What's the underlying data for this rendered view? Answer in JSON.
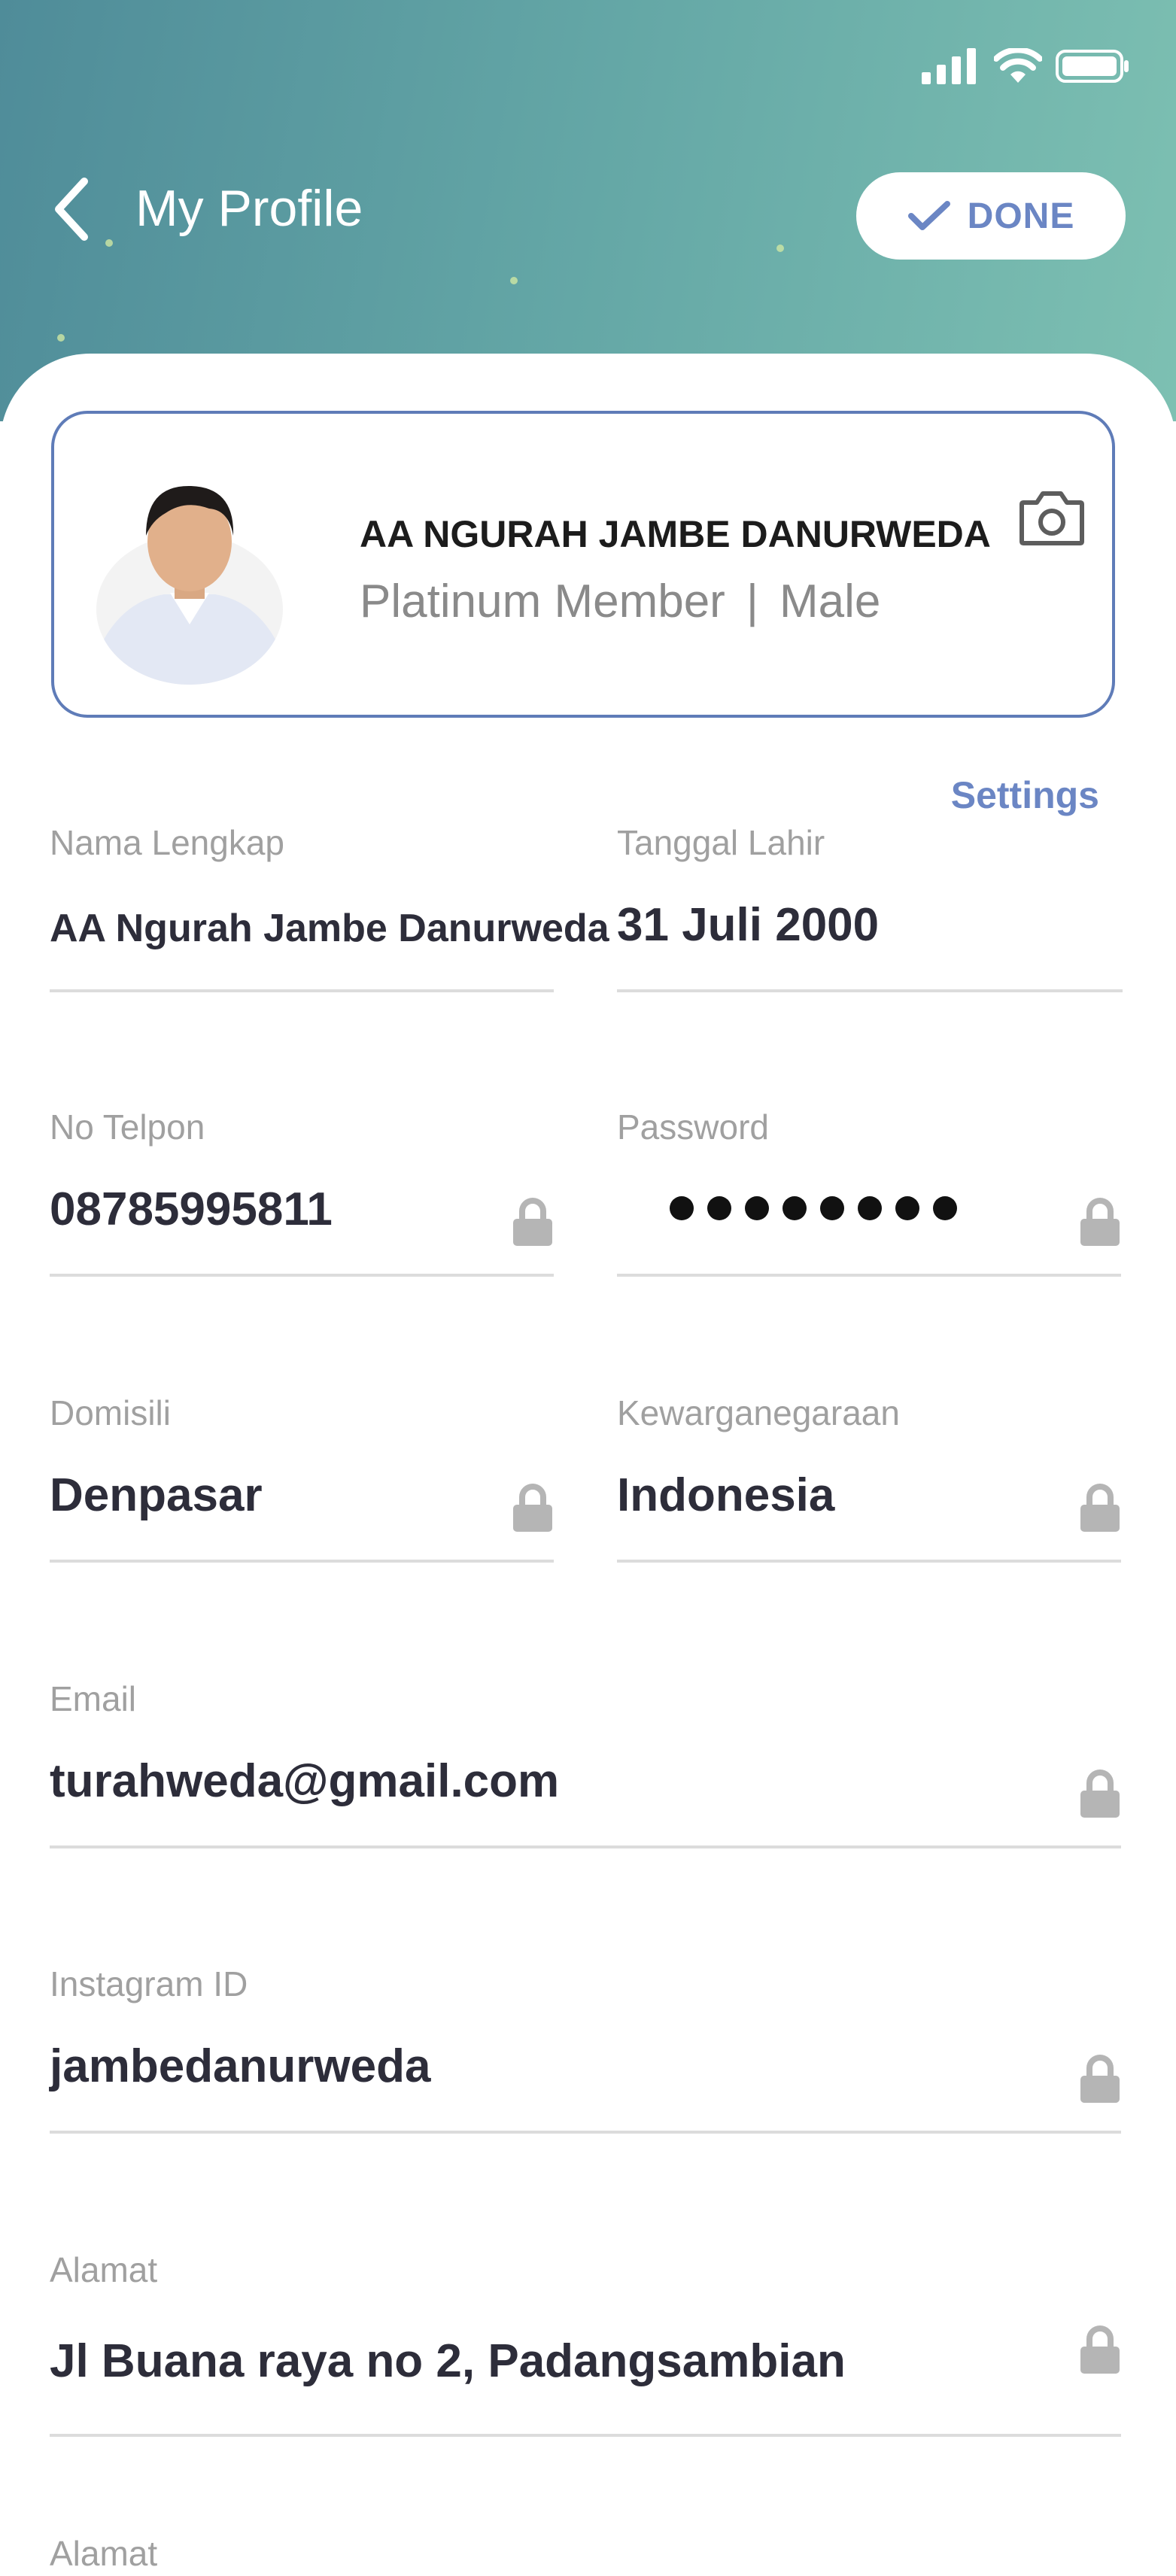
{
  "header": {
    "title": "My Profile",
    "done_label": "DONE"
  },
  "profile": {
    "name": "AA NGURAH JAMBE DANURWEDA",
    "membership": "Platinum Member",
    "separator": "|",
    "gender": "Male"
  },
  "settings_link": "Settings",
  "fields": {
    "full_name": {
      "label": "Nama Lengkap",
      "value": "AA Ngurah Jambe Danurweda"
    },
    "birth_date": {
      "label": "Tanggal Lahir",
      "value": "31 Juli 2000"
    },
    "phone": {
      "label": "No Telpon",
      "value": "08785995811",
      "locked": true
    },
    "password": {
      "label": "Password",
      "masked_length": 8,
      "locked": true
    },
    "domicile": {
      "label": "Domisili",
      "value": "Denpasar",
      "locked": true
    },
    "citizenship": {
      "label": "Kewarganegaraan",
      "value": "Indonesia",
      "locked": true
    },
    "email": {
      "label": "Email",
      "value": "turahweda@gmail.com",
      "locked": true
    },
    "instagram": {
      "label": "Instagram ID",
      "value": "jambedanurweda",
      "locked": true
    },
    "address": {
      "label": "Alamat",
      "value": "Jl Buana raya no 2, Padangsambian",
      "locked": true
    }
  },
  "colors": {
    "accent": "#6b86c4",
    "header_gradient_start": "#4f8c99",
    "header_gradient_end": "#7dc0b2",
    "lock_gray": "#b5b5b5"
  },
  "icons": [
    "signal-icon",
    "wifi-icon",
    "battery-icon",
    "back-arrow-icon",
    "checkmark-icon",
    "camera-icon",
    "lock-icon"
  ]
}
